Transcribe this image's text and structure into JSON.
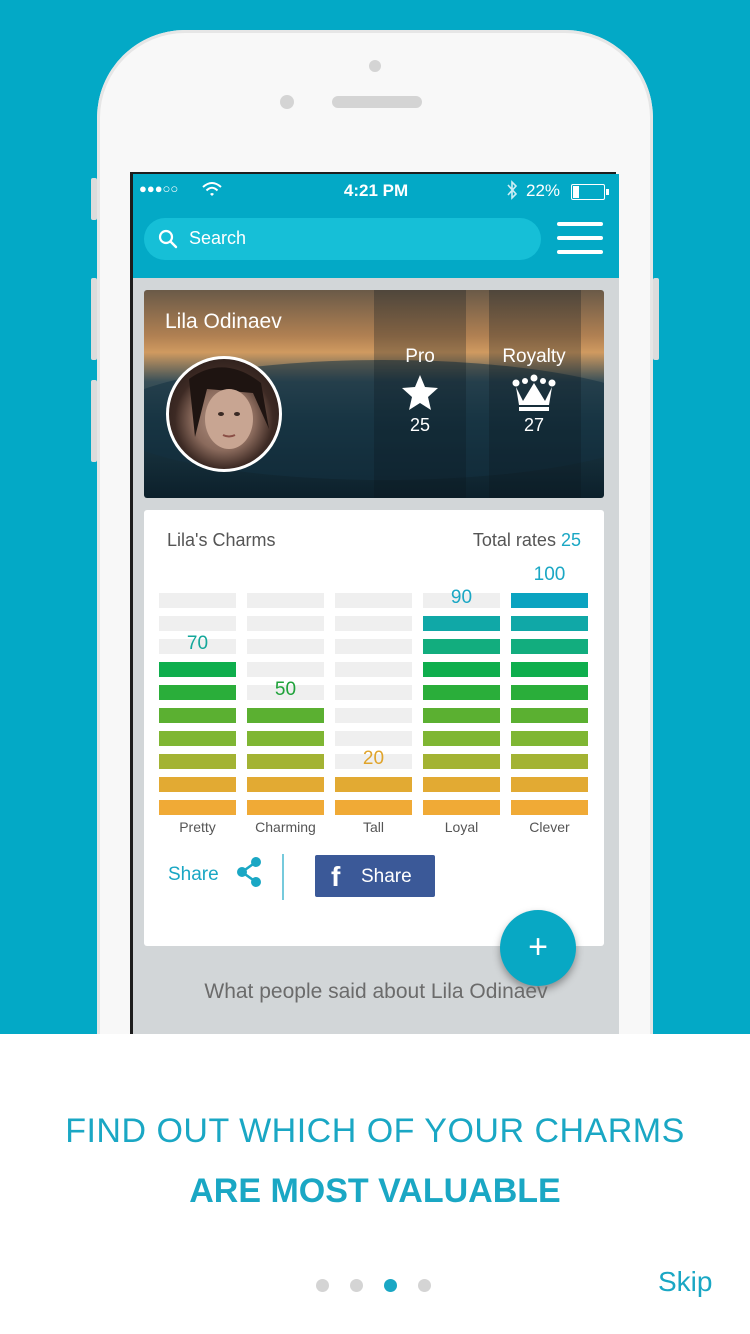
{
  "status_bar": {
    "signal": "●●●○○",
    "time": "4:21 PM",
    "battery_percent": "22%",
    "battery_level": 0.22
  },
  "search": {
    "placeholder": "Search"
  },
  "profile": {
    "name": "Lila Odinaev",
    "stats": [
      {
        "label": "Pro",
        "icon": "star-icon",
        "value": "25"
      },
      {
        "label": "Royalty",
        "icon": "crown-icon",
        "value": "27"
      }
    ]
  },
  "charms": {
    "title": "Lila's Charms",
    "total_label": "Total rates",
    "total_value": "25"
  },
  "chart_data": {
    "type": "bar",
    "categories": [
      "Pretty",
      "Charming",
      "Tall",
      "Loyal",
      "Clever"
    ],
    "values": [
      70,
      50,
      20,
      90,
      100
    ],
    "ylim": [
      0,
      100
    ],
    "segments": 10,
    "segment_colors": [
      "#f0aa36",
      "#e2aa33",
      "#a3b333",
      "#7fb633",
      "#5bb031",
      "#2aae3a",
      "#0eae4d",
      "#12ad7e",
      "#10a8a7",
      "#0aa3c0"
    ],
    "empty_color": "#efefef",
    "label_colors": [
      "#14a79a",
      "#1fa23a",
      "#e0a42b",
      "#1aa7c4",
      "#1aa7c4"
    ]
  },
  "share": {
    "share_label": "Share",
    "facebook_label": "Share",
    "facebook_f": "f"
  },
  "fab_label": "+",
  "reviews_heading": "What people said about Lila Odinaev",
  "onboarding": {
    "line1": "FIND OUT WHICH OF YOUR CHARMS",
    "line2": "ARE MOST VALUABLE",
    "pages": 4,
    "active_page": 3,
    "skip": "Skip"
  },
  "colors": {
    "brand": "#03a9c6",
    "accent_text": "#1aa7c4",
    "facebook": "#3b5998"
  }
}
